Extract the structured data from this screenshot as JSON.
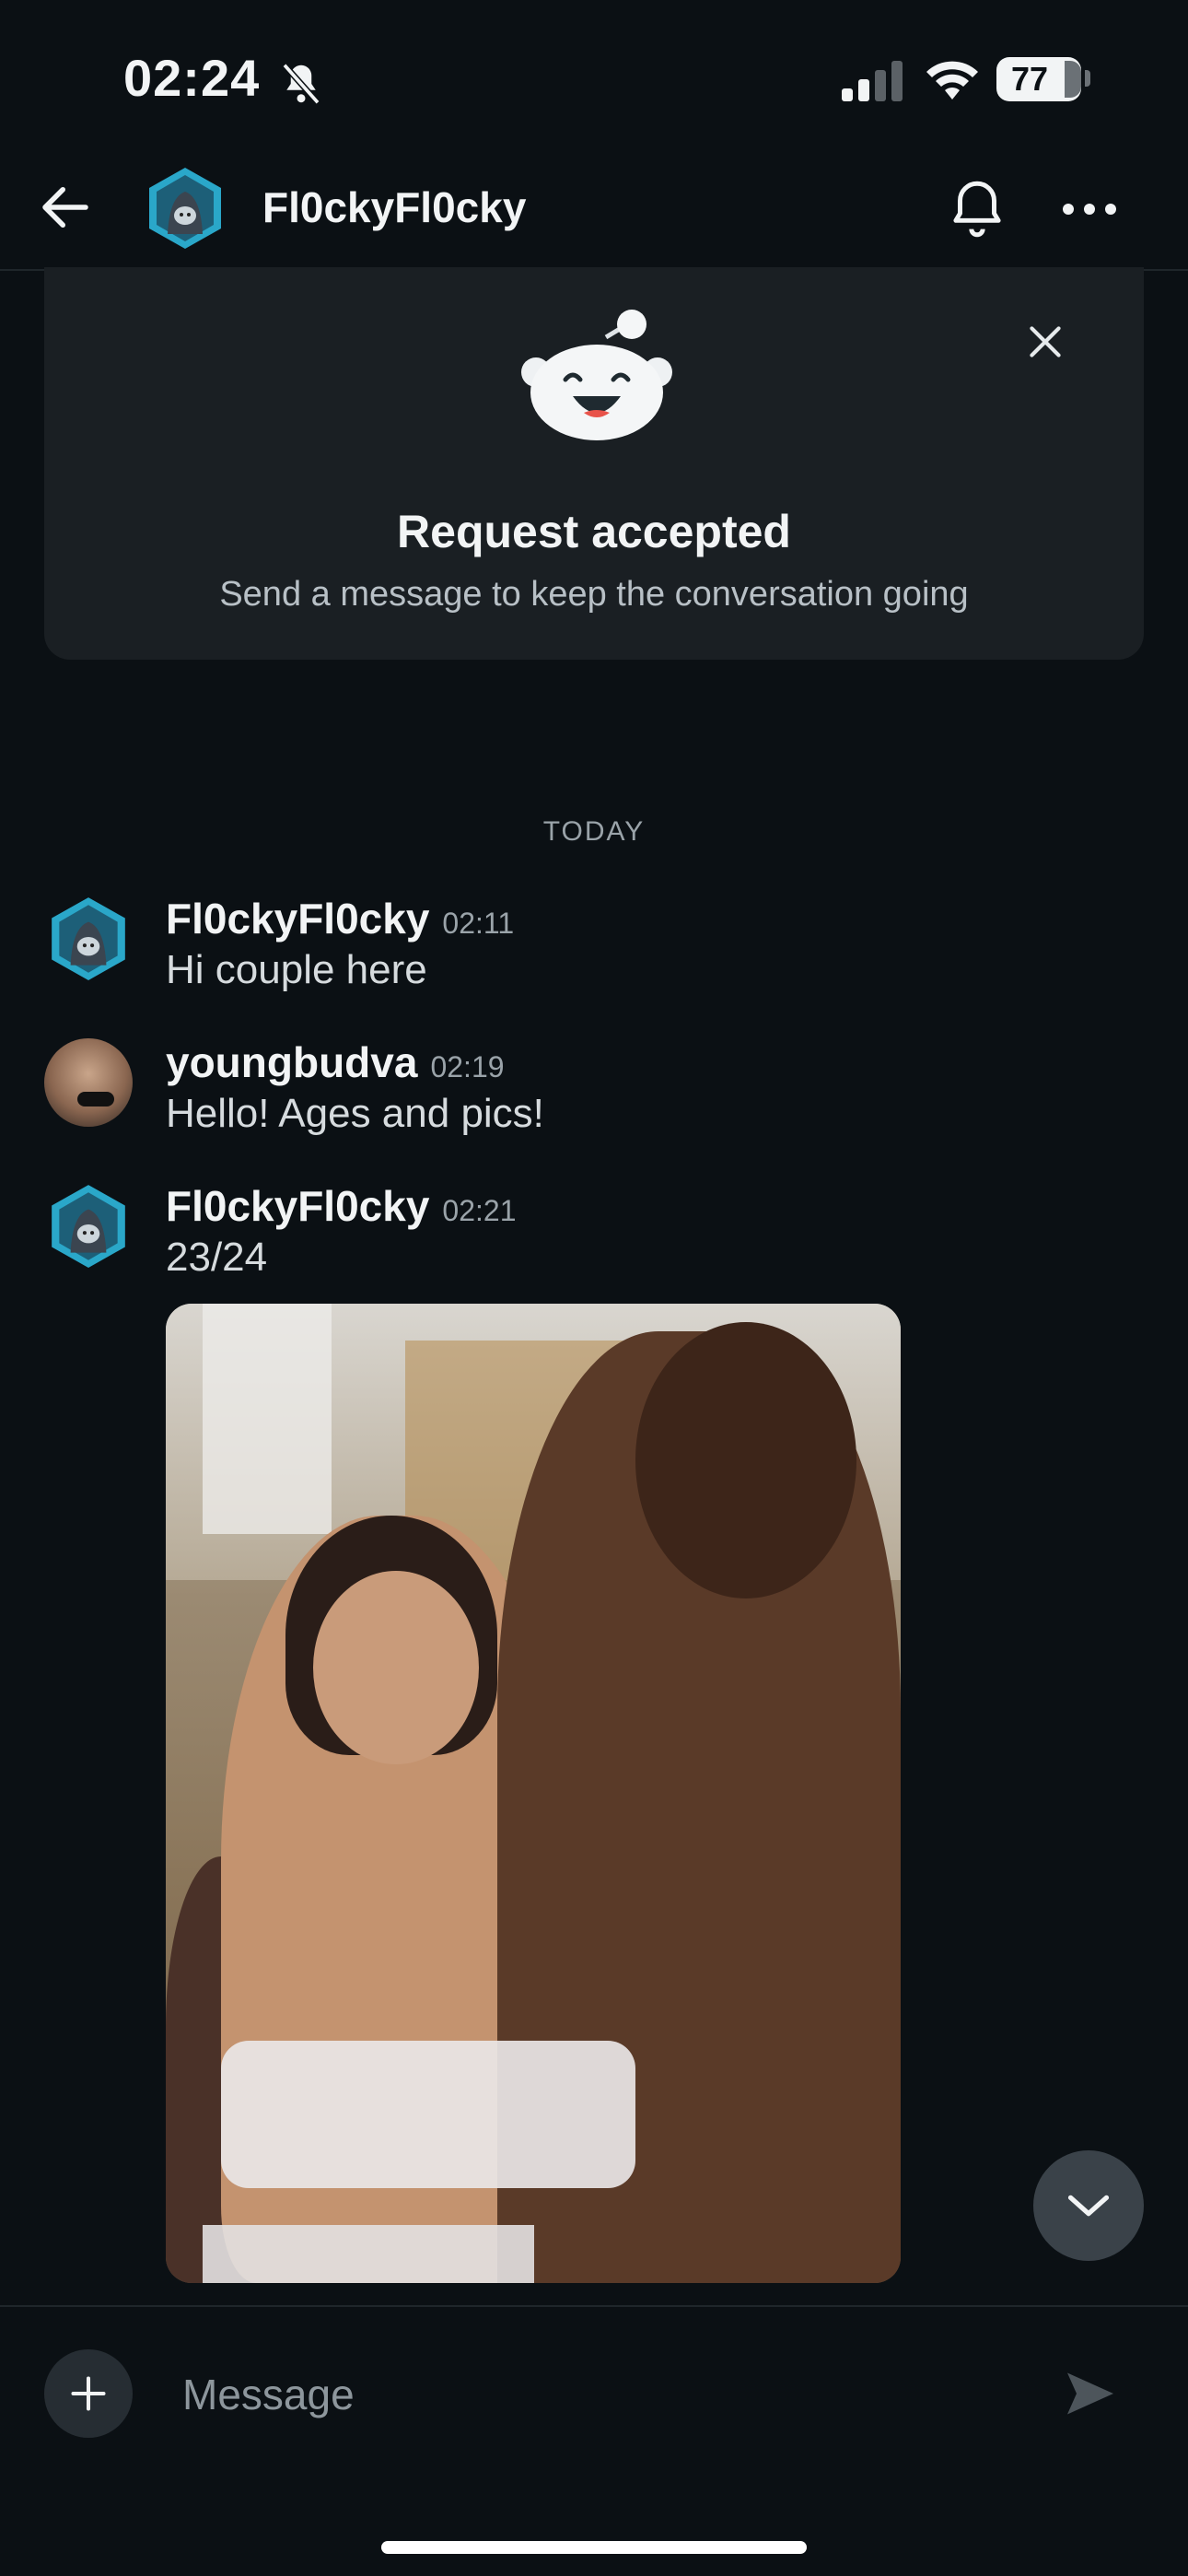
{
  "status_bar": {
    "time": "02:24",
    "battery": "77"
  },
  "header": {
    "title": "Fl0ckyFl0cky"
  },
  "banner": {
    "title": "Request accepted",
    "subtitle": "Send a message to keep the conversation going"
  },
  "date_separator": "TODAY",
  "messages": [
    {
      "author": "Fl0ckyFl0cky",
      "time": "02:11",
      "text": "Hi couple here"
    },
    {
      "author": "youngbudva",
      "time": "02:19",
      "text": "Hello! Ages and pics!"
    },
    {
      "author": "Fl0ckyFl0cky",
      "time": "02:21",
      "text": "23/24"
    }
  ],
  "composer": {
    "placeholder": "Message"
  },
  "colors": {
    "background": "#0b1014",
    "banner": "#1a1f23",
    "accent_avatar": "#39b6d6"
  }
}
